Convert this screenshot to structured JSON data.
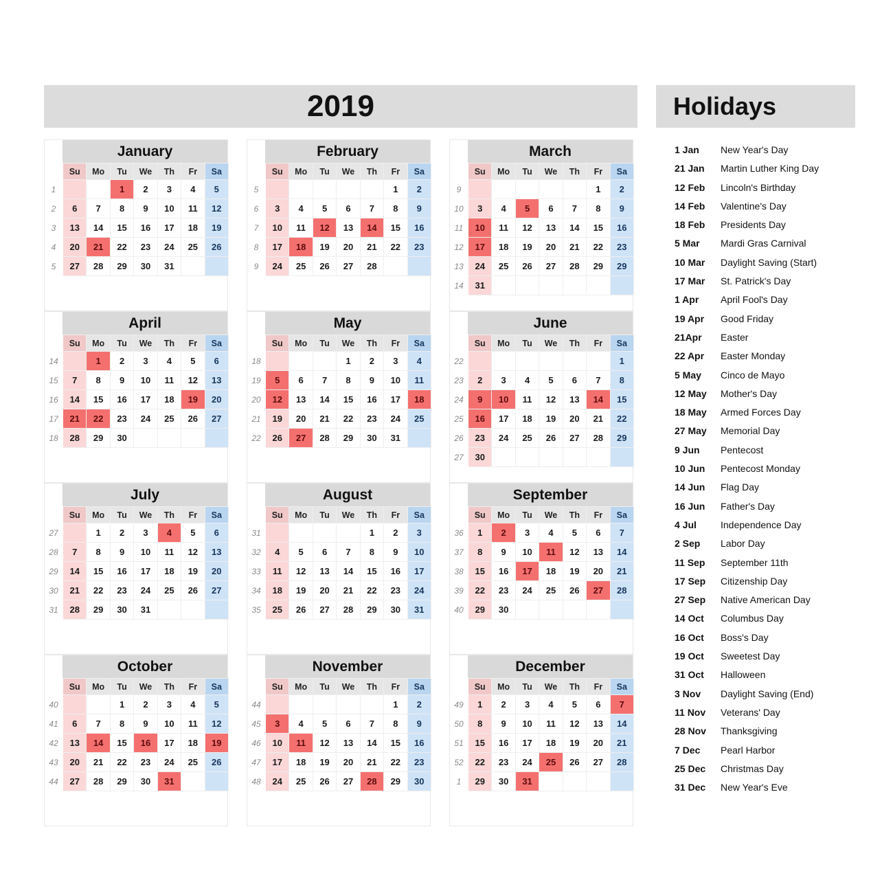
{
  "header": {
    "year": "2019",
    "holidays_title": "Holidays"
  },
  "weekday_headers": [
    "Su",
    "Mo",
    "Tu",
    "We",
    "Th",
    "Fr",
    "Sa"
  ],
  "colors": {
    "banner_gray": "#dcdcdc",
    "month_header_gray": "#d9d9d9",
    "weekday_header_gray": "#e6e6e6",
    "sunday_header_pink": "#f0c8c8",
    "saturday_header_blue": "#b9d5f0",
    "sunday_cell_pink": "#fbd7d7",
    "saturday_cell_blue": "#cfe3f7",
    "highlight_red": "#f4706f",
    "highlight_text": "#5b0c0c",
    "week_number_gray": "#8a8a8a"
  },
  "months": [
    {
      "name": "January",
      "weeks": [
        {
          "wk": "1",
          "days": [
            "",
            "",
            "1",
            "2",
            "3",
            "4",
            "5"
          ],
          "hl": [
            "1"
          ]
        },
        {
          "wk": "2",
          "days": [
            "6",
            "7",
            "8",
            "9",
            "10",
            "11",
            "12"
          ],
          "hl": []
        },
        {
          "wk": "3",
          "days": [
            "13",
            "14",
            "15",
            "16",
            "17",
            "18",
            "19"
          ],
          "hl": []
        },
        {
          "wk": "4",
          "days": [
            "20",
            "21",
            "22",
            "23",
            "24",
            "25",
            "26"
          ],
          "hl": [
            "21"
          ]
        },
        {
          "wk": "5",
          "days": [
            "27",
            "28",
            "29",
            "30",
            "31",
            "",
            ""
          ],
          "hl": []
        }
      ]
    },
    {
      "name": "February",
      "weeks": [
        {
          "wk": "5",
          "days": [
            "",
            "",
            "",
            "",
            "",
            "1",
            "2"
          ],
          "hl": []
        },
        {
          "wk": "6",
          "days": [
            "3",
            "4",
            "5",
            "6",
            "7",
            "8",
            "9"
          ],
          "hl": []
        },
        {
          "wk": "7",
          "days": [
            "10",
            "11",
            "12",
            "13",
            "14",
            "15",
            "16"
          ],
          "hl": [
            "12",
            "14"
          ]
        },
        {
          "wk": "8",
          "days": [
            "17",
            "18",
            "19",
            "20",
            "21",
            "22",
            "23"
          ],
          "hl": [
            "18"
          ]
        },
        {
          "wk": "9",
          "days": [
            "24",
            "25",
            "26",
            "27",
            "28",
            "",
            ""
          ],
          "hl": []
        }
      ]
    },
    {
      "name": "March",
      "weeks": [
        {
          "wk": "9",
          "days": [
            "",
            "",
            "",
            "",
            "",
            "1",
            "2"
          ],
          "hl": []
        },
        {
          "wk": "10",
          "days": [
            "3",
            "4",
            "5",
            "6",
            "7",
            "8",
            "9"
          ],
          "hl": [
            "5"
          ]
        },
        {
          "wk": "11",
          "days": [
            "10",
            "11",
            "12",
            "13",
            "14",
            "15",
            "16"
          ],
          "hl": [
            "10"
          ]
        },
        {
          "wk": "12",
          "days": [
            "17",
            "18",
            "19",
            "20",
            "21",
            "22",
            "23"
          ],
          "hl": [
            "17"
          ]
        },
        {
          "wk": "13",
          "days": [
            "24",
            "25",
            "26",
            "27",
            "28",
            "29",
            "29"
          ],
          "hl": []
        },
        {
          "wk": "14",
          "days": [
            "31",
            "",
            "",
            "",
            "",
            "",
            ""
          ],
          "hl": []
        }
      ]
    },
    {
      "name": "April",
      "weeks": [
        {
          "wk": "14",
          "days": [
            "",
            "1",
            "2",
            "3",
            "4",
            "5",
            "6"
          ],
          "hl": [
            "1"
          ]
        },
        {
          "wk": "15",
          "days": [
            "7",
            "8",
            "9",
            "10",
            "11",
            "12",
            "13"
          ],
          "hl": []
        },
        {
          "wk": "16",
          "days": [
            "14",
            "15",
            "16",
            "17",
            "18",
            "19",
            "20"
          ],
          "hl": [
            "19"
          ]
        },
        {
          "wk": "17",
          "days": [
            "21",
            "22",
            "23",
            "24",
            "25",
            "26",
            "27"
          ],
          "hl": [
            "21",
            "22"
          ]
        },
        {
          "wk": "18",
          "days": [
            "28",
            "29",
            "30",
            "",
            "",
            "",
            ""
          ],
          "hl": []
        }
      ]
    },
    {
      "name": "May",
      "weeks": [
        {
          "wk": "18",
          "days": [
            "",
            "",
            "",
            "1",
            "2",
            "3",
            "4"
          ],
          "hl": []
        },
        {
          "wk": "19",
          "days": [
            "5",
            "6",
            "7",
            "8",
            "9",
            "10",
            "11"
          ],
          "hl": [
            "5"
          ]
        },
        {
          "wk": "20",
          "days": [
            "12",
            "13",
            "14",
            "15",
            "16",
            "17",
            "18"
          ],
          "hl": [
            "12",
            "18"
          ]
        },
        {
          "wk": "21",
          "days": [
            "19",
            "20",
            "21",
            "22",
            "23",
            "24",
            "25"
          ],
          "hl": []
        },
        {
          "wk": "22",
          "days": [
            "26",
            "27",
            "28",
            "29",
            "30",
            "31",
            ""
          ],
          "hl": [
            "27"
          ]
        }
      ]
    },
    {
      "name": "June",
      "weeks": [
        {
          "wk": "22",
          "days": [
            "",
            "",
            "",
            "",
            "",
            "",
            "1"
          ],
          "hl": []
        },
        {
          "wk": "23",
          "days": [
            "2",
            "3",
            "4",
            "5",
            "6",
            "7",
            "8"
          ],
          "hl": []
        },
        {
          "wk": "24",
          "days": [
            "9",
            "10",
            "11",
            "12",
            "13",
            "14",
            "15"
          ],
          "hl": [
            "9",
            "10",
            "14"
          ]
        },
        {
          "wk": "25",
          "days": [
            "16",
            "17",
            "18",
            "19",
            "20",
            "21",
            "22"
          ],
          "hl": [
            "16"
          ]
        },
        {
          "wk": "26",
          "days": [
            "23",
            "24",
            "25",
            "26",
            "27",
            "28",
            "29"
          ],
          "hl": []
        },
        {
          "wk": "27",
          "days": [
            "30",
            "",
            "",
            "",
            "",
            "",
            ""
          ],
          "hl": []
        }
      ]
    },
    {
      "name": "July",
      "weeks": [
        {
          "wk": "27",
          "days": [
            "",
            "1",
            "2",
            "3",
            "4",
            "5",
            "6"
          ],
          "hl": [
            "4"
          ]
        },
        {
          "wk": "28",
          "days": [
            "7",
            "8",
            "9",
            "10",
            "11",
            "12",
            "13"
          ],
          "hl": []
        },
        {
          "wk": "29",
          "days": [
            "14",
            "15",
            "16",
            "17",
            "18",
            "19",
            "20"
          ],
          "hl": []
        },
        {
          "wk": "30",
          "days": [
            "21",
            "22",
            "23",
            "24",
            "25",
            "26",
            "27"
          ],
          "hl": []
        },
        {
          "wk": "31",
          "days": [
            "28",
            "29",
            "30",
            "31",
            "",
            "",
            ""
          ],
          "hl": []
        }
      ]
    },
    {
      "name": "August",
      "weeks": [
        {
          "wk": "31",
          "days": [
            "",
            "",
            "",
            "",
            "1",
            "2",
            "3"
          ],
          "hl": []
        },
        {
          "wk": "32",
          "days": [
            "4",
            "5",
            "6",
            "7",
            "8",
            "9",
            "10"
          ],
          "hl": []
        },
        {
          "wk": "33",
          "days": [
            "11",
            "12",
            "13",
            "14",
            "15",
            "16",
            "17"
          ],
          "hl": []
        },
        {
          "wk": "34",
          "days": [
            "18",
            "19",
            "20",
            "21",
            "22",
            "23",
            "24"
          ],
          "hl": []
        },
        {
          "wk": "35",
          "days": [
            "25",
            "26",
            "27",
            "28",
            "29",
            "30",
            "31"
          ],
          "hl": []
        }
      ]
    },
    {
      "name": "September",
      "weeks": [
        {
          "wk": "36",
          "days": [
            "1",
            "2",
            "3",
            "4",
            "5",
            "6",
            "7"
          ],
          "hl": [
            "2"
          ]
        },
        {
          "wk": "37",
          "days": [
            "8",
            "9",
            "10",
            "11",
            "12",
            "13",
            "14"
          ],
          "hl": [
            "11"
          ]
        },
        {
          "wk": "38",
          "days": [
            "15",
            "16",
            "17",
            "18",
            "19",
            "20",
            "21"
          ],
          "hl": [
            "17"
          ]
        },
        {
          "wk": "39",
          "days": [
            "22",
            "23",
            "24",
            "25",
            "26",
            "27",
            "28"
          ],
          "hl": [
            "27"
          ]
        },
        {
          "wk": "40",
          "days": [
            "29",
            "30",
            "",
            "",
            "",
            "",
            ""
          ],
          "hl": []
        }
      ]
    },
    {
      "name": "October",
      "weeks": [
        {
          "wk": "40",
          "days": [
            "",
            "",
            "1",
            "2",
            "3",
            "4",
            "5"
          ],
          "hl": []
        },
        {
          "wk": "41",
          "days": [
            "6",
            "7",
            "8",
            "9",
            "10",
            "11",
            "12"
          ],
          "hl": []
        },
        {
          "wk": "42",
          "days": [
            "13",
            "14",
            "15",
            "16",
            "17",
            "18",
            "19"
          ],
          "hl": [
            "14",
            "16",
            "19"
          ]
        },
        {
          "wk": "43",
          "days": [
            "20",
            "21",
            "22",
            "23",
            "24",
            "25",
            "26"
          ],
          "hl": []
        },
        {
          "wk": "44",
          "days": [
            "27",
            "28",
            "29",
            "30",
            "31",
            "",
            ""
          ],
          "hl": [
            "31"
          ]
        }
      ]
    },
    {
      "name": "November",
      "weeks": [
        {
          "wk": "44",
          "days": [
            "",
            "",
            "",
            "",
            "",
            "1",
            "2"
          ],
          "hl": []
        },
        {
          "wk": "45",
          "days": [
            "3",
            "4",
            "5",
            "6",
            "7",
            "8",
            "9"
          ],
          "hl": [
            "3"
          ]
        },
        {
          "wk": "46",
          "days": [
            "10",
            "11",
            "12",
            "13",
            "14",
            "15",
            "16"
          ],
          "hl": [
            "11"
          ]
        },
        {
          "wk": "47",
          "days": [
            "17",
            "18",
            "19",
            "20",
            "21",
            "22",
            "23"
          ],
          "hl": []
        },
        {
          "wk": "48",
          "days": [
            "24",
            "25",
            "26",
            "27",
            "28",
            "29",
            "30"
          ],
          "hl": [
            "28"
          ]
        }
      ]
    },
    {
      "name": "December",
      "weeks": [
        {
          "wk": "49",
          "days": [
            "1",
            "2",
            "3",
            "4",
            "5",
            "6",
            "7"
          ],
          "hl": [
            "7"
          ]
        },
        {
          "wk": "50",
          "days": [
            "8",
            "9",
            "10",
            "11",
            "12",
            "13",
            "14"
          ],
          "hl": []
        },
        {
          "wk": "51",
          "days": [
            "15",
            "16",
            "17",
            "18",
            "19",
            "20",
            "21"
          ],
          "hl": []
        },
        {
          "wk": "52",
          "days": [
            "22",
            "23",
            "24",
            "25",
            "26",
            "27",
            "28"
          ],
          "hl": [
            "25"
          ]
        },
        {
          "wk": "1",
          "days": [
            "29",
            "30",
            "31",
            "",
            "",
            "",
            ""
          ],
          "hl": [
            "31"
          ]
        }
      ]
    }
  ],
  "holidays": [
    {
      "date": "1 Jan",
      "name": "New Year's Day"
    },
    {
      "date": "21 Jan",
      "name": "Martin Luther King Day"
    },
    {
      "date": "12 Feb",
      "name": "Lincoln's Birthday"
    },
    {
      "date": "14 Feb",
      "name": "Valentine's Day"
    },
    {
      "date": "18 Feb",
      "name": "Presidents Day"
    },
    {
      "date": "5 Mar",
      "name": "Mardi Gras Carnival"
    },
    {
      "date": "10 Mar",
      "name": "Daylight Saving (Start)"
    },
    {
      "date": "17 Mar",
      "name": "St. Patrick's Day"
    },
    {
      "date": "1 Apr",
      "name": "April Fool's Day"
    },
    {
      "date": "19 Apr",
      "name": "Good Friday"
    },
    {
      "date": "21Apr",
      "name": "Easter"
    },
    {
      "date": "22 Apr",
      "name": "Easter Monday"
    },
    {
      "date": "5 May",
      "name": "Cinco de Mayo"
    },
    {
      "date": "12 May",
      "name": "Mother's Day"
    },
    {
      "date": "18 May",
      "name": "Armed Forces Day"
    },
    {
      "date": "27 May",
      "name": "Memorial Day"
    },
    {
      "date": "9 Jun",
      "name": "Pentecost"
    },
    {
      "date": "10 Jun",
      "name": "Pentecost Monday"
    },
    {
      "date": "14 Jun",
      "name": "Flag Day"
    },
    {
      "date": "16 Jun",
      "name": "Father's Day"
    },
    {
      "date": "4 Jul",
      "name": "Independence Day"
    },
    {
      "date": "2 Sep",
      "name": "Labor Day"
    },
    {
      "date": "11 Sep",
      "name": "September 11th"
    },
    {
      "date": "17 Sep",
      "name": "Citizenship Day"
    },
    {
      "date": "27 Sep",
      "name": "Native American Day"
    },
    {
      "date": "14 Oct",
      "name": "Columbus Day"
    },
    {
      "date": "16 Oct",
      "name": "Boss's Day"
    },
    {
      "date": "19 Oct",
      "name": "Sweetest Day"
    },
    {
      "date": "31 Oct",
      "name": "Halloween"
    },
    {
      "date": "3 Nov",
      "name": "Daylight Saving (End)"
    },
    {
      "date": "11 Nov",
      "name": "Veterans' Day"
    },
    {
      "date": "28 Nov",
      "name": "Thanksgiving"
    },
    {
      "date": "7 Dec",
      "name": "Pearl Harbor"
    },
    {
      "date": "25 Dec",
      "name": "Christmas Day"
    },
    {
      "date": "31 Dec",
      "name": "New Year's Eve"
    }
  ]
}
